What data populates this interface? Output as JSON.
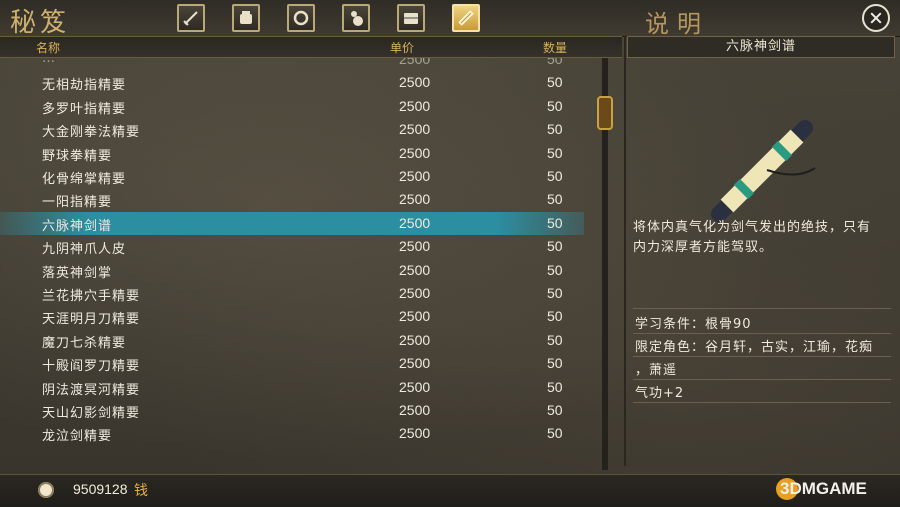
{
  "window": {
    "left_title": "秘笈",
    "right_title": "说明",
    "close_icon": "close-icon"
  },
  "tabs": [
    {
      "icon": "sword-icon",
      "active": false
    },
    {
      "icon": "fist-icon",
      "active": false
    },
    {
      "icon": "ring-icon",
      "active": false
    },
    {
      "icon": "gourd-icon",
      "active": false
    },
    {
      "icon": "book-icon",
      "active": false
    },
    {
      "icon": "scroll-icon",
      "active": true
    }
  ],
  "table": {
    "headers": {
      "name": "名称",
      "price": "单价",
      "qty": "数量"
    },
    "rows": [
      {
        "name": "…",
        "price": "2500",
        "qty": "50",
        "cut": true
      },
      {
        "name": "无相劫指精要",
        "price": "2500",
        "qty": "50"
      },
      {
        "name": "多罗叶指精要",
        "price": "2500",
        "qty": "50"
      },
      {
        "name": "大金刚拳法精要",
        "price": "2500",
        "qty": "50"
      },
      {
        "name": "野球拳精要",
        "price": "2500",
        "qty": "50"
      },
      {
        "name": "化骨绵掌精要",
        "price": "2500",
        "qty": "50"
      },
      {
        "name": "一阳指精要",
        "price": "2500",
        "qty": "50"
      },
      {
        "name": "六脉神剑谱",
        "price": "2500",
        "qty": "50",
        "selected": true
      },
      {
        "name": "九阴神爪人皮",
        "price": "2500",
        "qty": "50"
      },
      {
        "name": "落英神剑掌",
        "price": "2500",
        "qty": "50"
      },
      {
        "name": "兰花拂穴手精要",
        "price": "2500",
        "qty": "50"
      },
      {
        "name": "天涯明月刀精要",
        "price": "2500",
        "qty": "50"
      },
      {
        "name": "魔刀七杀精要",
        "price": "2500",
        "qty": "50"
      },
      {
        "name": "十殿阎罗刀精要",
        "price": "2500",
        "qty": "50"
      },
      {
        "name": "阴法渡冥河精要",
        "price": "2500",
        "qty": "50"
      },
      {
        "name": "天山幻影剑精要",
        "price": "2500",
        "qty": "50"
      },
      {
        "name": "龙泣剑精要",
        "price": "2500",
        "qty": "50"
      }
    ]
  },
  "detail": {
    "title": "六脉神剑谱",
    "item_icon": "scroll-item-icon",
    "description_1": "将体内真气化为剑气发出的绝技，只有",
    "description_2": "内力深厚者方能驾驭。",
    "requirement": "学习条件：根骨90",
    "roles_1": "限定角色：谷月轩，古实，江瑜，花痴",
    "roles_2": "，萧遥",
    "bonus": "气功+2"
  },
  "footer": {
    "money": "9509128",
    "money_unit": "钱",
    "watermark": "3DMGAME"
  },
  "colors": {
    "selected_row": "#2c8ea1",
    "header_text": "#d9b25a",
    "gold": "#cdb070"
  }
}
